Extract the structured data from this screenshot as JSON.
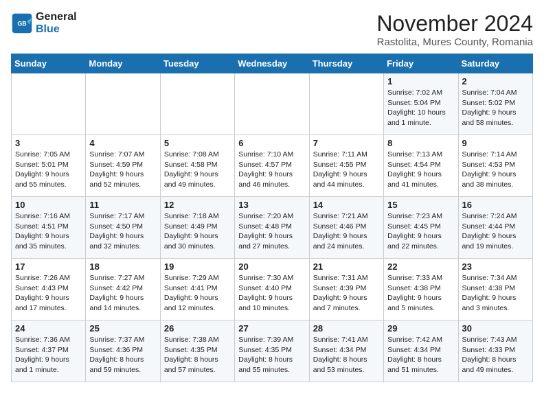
{
  "logo": {
    "line1": "General",
    "line2": "Blue"
  },
  "title": "November 2024",
  "location": "Rastolita, Mures County, Romania",
  "weekdays": [
    "Sunday",
    "Monday",
    "Tuesday",
    "Wednesday",
    "Thursday",
    "Friday",
    "Saturday"
  ],
  "weeks": [
    [
      {
        "day": "",
        "info": ""
      },
      {
        "day": "",
        "info": ""
      },
      {
        "day": "",
        "info": ""
      },
      {
        "day": "",
        "info": ""
      },
      {
        "day": "",
        "info": ""
      },
      {
        "day": "1",
        "info": "Sunrise: 7:02 AM\nSunset: 5:04 PM\nDaylight: 10 hours and 1 minute."
      },
      {
        "day": "2",
        "info": "Sunrise: 7:04 AM\nSunset: 5:02 PM\nDaylight: 9 hours and 58 minutes."
      }
    ],
    [
      {
        "day": "3",
        "info": "Sunrise: 7:05 AM\nSunset: 5:01 PM\nDaylight: 9 hours and 55 minutes."
      },
      {
        "day": "4",
        "info": "Sunrise: 7:07 AM\nSunset: 4:59 PM\nDaylight: 9 hours and 52 minutes."
      },
      {
        "day": "5",
        "info": "Sunrise: 7:08 AM\nSunset: 4:58 PM\nDaylight: 9 hours and 49 minutes."
      },
      {
        "day": "6",
        "info": "Sunrise: 7:10 AM\nSunset: 4:57 PM\nDaylight: 9 hours and 46 minutes."
      },
      {
        "day": "7",
        "info": "Sunrise: 7:11 AM\nSunset: 4:55 PM\nDaylight: 9 hours and 44 minutes."
      },
      {
        "day": "8",
        "info": "Sunrise: 7:13 AM\nSunset: 4:54 PM\nDaylight: 9 hours and 41 minutes."
      },
      {
        "day": "9",
        "info": "Sunrise: 7:14 AM\nSunset: 4:53 PM\nDaylight: 9 hours and 38 minutes."
      }
    ],
    [
      {
        "day": "10",
        "info": "Sunrise: 7:16 AM\nSunset: 4:51 PM\nDaylight: 9 hours and 35 minutes."
      },
      {
        "day": "11",
        "info": "Sunrise: 7:17 AM\nSunset: 4:50 PM\nDaylight: 9 hours and 32 minutes."
      },
      {
        "day": "12",
        "info": "Sunrise: 7:18 AM\nSunset: 4:49 PM\nDaylight: 9 hours and 30 minutes."
      },
      {
        "day": "13",
        "info": "Sunrise: 7:20 AM\nSunset: 4:48 PM\nDaylight: 9 hours and 27 minutes."
      },
      {
        "day": "14",
        "info": "Sunrise: 7:21 AM\nSunset: 4:46 PM\nDaylight: 9 hours and 24 minutes."
      },
      {
        "day": "15",
        "info": "Sunrise: 7:23 AM\nSunset: 4:45 PM\nDaylight: 9 hours and 22 minutes."
      },
      {
        "day": "16",
        "info": "Sunrise: 7:24 AM\nSunset: 4:44 PM\nDaylight: 9 hours and 19 minutes."
      }
    ],
    [
      {
        "day": "17",
        "info": "Sunrise: 7:26 AM\nSunset: 4:43 PM\nDaylight: 9 hours and 17 minutes."
      },
      {
        "day": "18",
        "info": "Sunrise: 7:27 AM\nSunset: 4:42 PM\nDaylight: 9 hours and 14 minutes."
      },
      {
        "day": "19",
        "info": "Sunrise: 7:29 AM\nSunset: 4:41 PM\nDaylight: 9 hours and 12 minutes."
      },
      {
        "day": "20",
        "info": "Sunrise: 7:30 AM\nSunset: 4:40 PM\nDaylight: 9 hours and 10 minutes."
      },
      {
        "day": "21",
        "info": "Sunrise: 7:31 AM\nSunset: 4:39 PM\nDaylight: 9 hours and 7 minutes."
      },
      {
        "day": "22",
        "info": "Sunrise: 7:33 AM\nSunset: 4:38 PM\nDaylight: 9 hours and 5 minutes."
      },
      {
        "day": "23",
        "info": "Sunrise: 7:34 AM\nSunset: 4:38 PM\nDaylight: 9 hours and 3 minutes."
      }
    ],
    [
      {
        "day": "24",
        "info": "Sunrise: 7:36 AM\nSunset: 4:37 PM\nDaylight: 9 hours and 1 minute."
      },
      {
        "day": "25",
        "info": "Sunrise: 7:37 AM\nSunset: 4:36 PM\nDaylight: 8 hours and 59 minutes."
      },
      {
        "day": "26",
        "info": "Sunrise: 7:38 AM\nSunset: 4:35 PM\nDaylight: 8 hours and 57 minutes."
      },
      {
        "day": "27",
        "info": "Sunrise: 7:39 AM\nSunset: 4:35 PM\nDaylight: 8 hours and 55 minutes."
      },
      {
        "day": "28",
        "info": "Sunrise: 7:41 AM\nSunset: 4:34 PM\nDaylight: 8 hours and 53 minutes."
      },
      {
        "day": "29",
        "info": "Sunrise: 7:42 AM\nSunset: 4:34 PM\nDaylight: 8 hours and 51 minutes."
      },
      {
        "day": "30",
        "info": "Sunrise: 7:43 AM\nSunset: 4:33 PM\nDaylight: 8 hours and 49 minutes."
      }
    ]
  ]
}
